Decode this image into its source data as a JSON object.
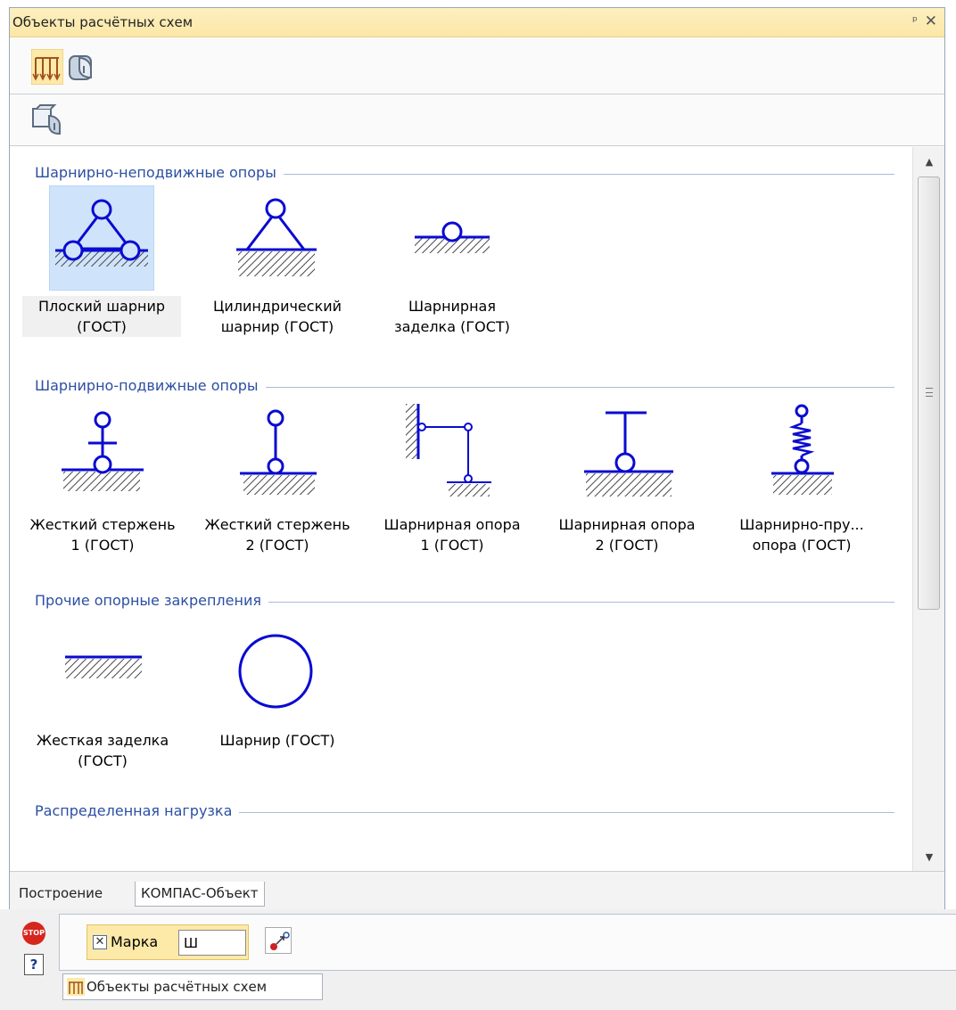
{
  "panel": {
    "title": "Объекты расчётных схем",
    "pin_glyph": "ᵖ",
    "close_glyph": "✕"
  },
  "toolbar": {
    "row1": [
      {
        "icon": "distributed-load-icon"
      },
      {
        "icon": "kompas-object-icon"
      }
    ],
    "row2": [
      {
        "icon": "library-objects-icon"
      }
    ]
  },
  "groups": [
    {
      "title": "Шарнирно-неподвижные опоры",
      "items": [
        {
          "line1": "Плоский шарнир",
          "line2": "(ГОСТ)",
          "icon": "flat-hinge-icon",
          "selected": true
        },
        {
          "line1": "Цилиндрический",
          "line2": "шарнир (ГОСТ)",
          "icon": "cylindrical-hinge-icon"
        },
        {
          "line1": "Шарнирная",
          "line2": "заделка (ГОСТ)",
          "icon": "hinged-embedding-icon"
        }
      ]
    },
    {
      "title": "Шарнирно-подвижные опоры",
      "items": [
        {
          "line1": "Жесткий стержень",
          "line2": "1 (ГОСТ)",
          "icon": "rigid-rod-1-icon"
        },
        {
          "line1": "Жесткий стержень",
          "line2": "2 (ГОСТ)",
          "icon": "rigid-rod-2-icon"
        },
        {
          "line1": "Шарнирная опора",
          "line2": "1 (ГОСТ)",
          "icon": "hinged-support-1-icon"
        },
        {
          "line1": "Шарнирная опора",
          "line2": "2 (ГОСТ)",
          "icon": "hinged-support-2-icon"
        },
        {
          "line1": "Шарнирно-пру...",
          "line2": "опора (ГОСТ)",
          "icon": "spring-hinged-support-icon"
        }
      ]
    },
    {
      "title": "Прочие опорные закрепления",
      "items": [
        {
          "line1": "Жесткая заделка",
          "line2": "(ГОСТ)",
          "icon": "rigid-embedding-icon"
        },
        {
          "line1": "Шарнир (ГОСТ)",
          "line2": "",
          "icon": "hinge-circle-icon"
        }
      ]
    },
    {
      "title": "Распределенная нагрузка",
      "items": []
    }
  ],
  "tabs": [
    {
      "label": "Построение"
    },
    {
      "label": "КОМПАС-Объект"
    }
  ],
  "status": {
    "stop_label": "STOP",
    "help_label": "?",
    "marka_label": "Марка",
    "marka_checked_glyph": "✕",
    "marka_value": "Ш",
    "bottom_tab_label": "Объекты расчётных схем"
  },
  "colors": {
    "accent_blue": "#0a0ad2",
    "header_blue": "#2b4fa3",
    "selection": "#cfe4fa",
    "titlebar": "#fbe7a6"
  }
}
